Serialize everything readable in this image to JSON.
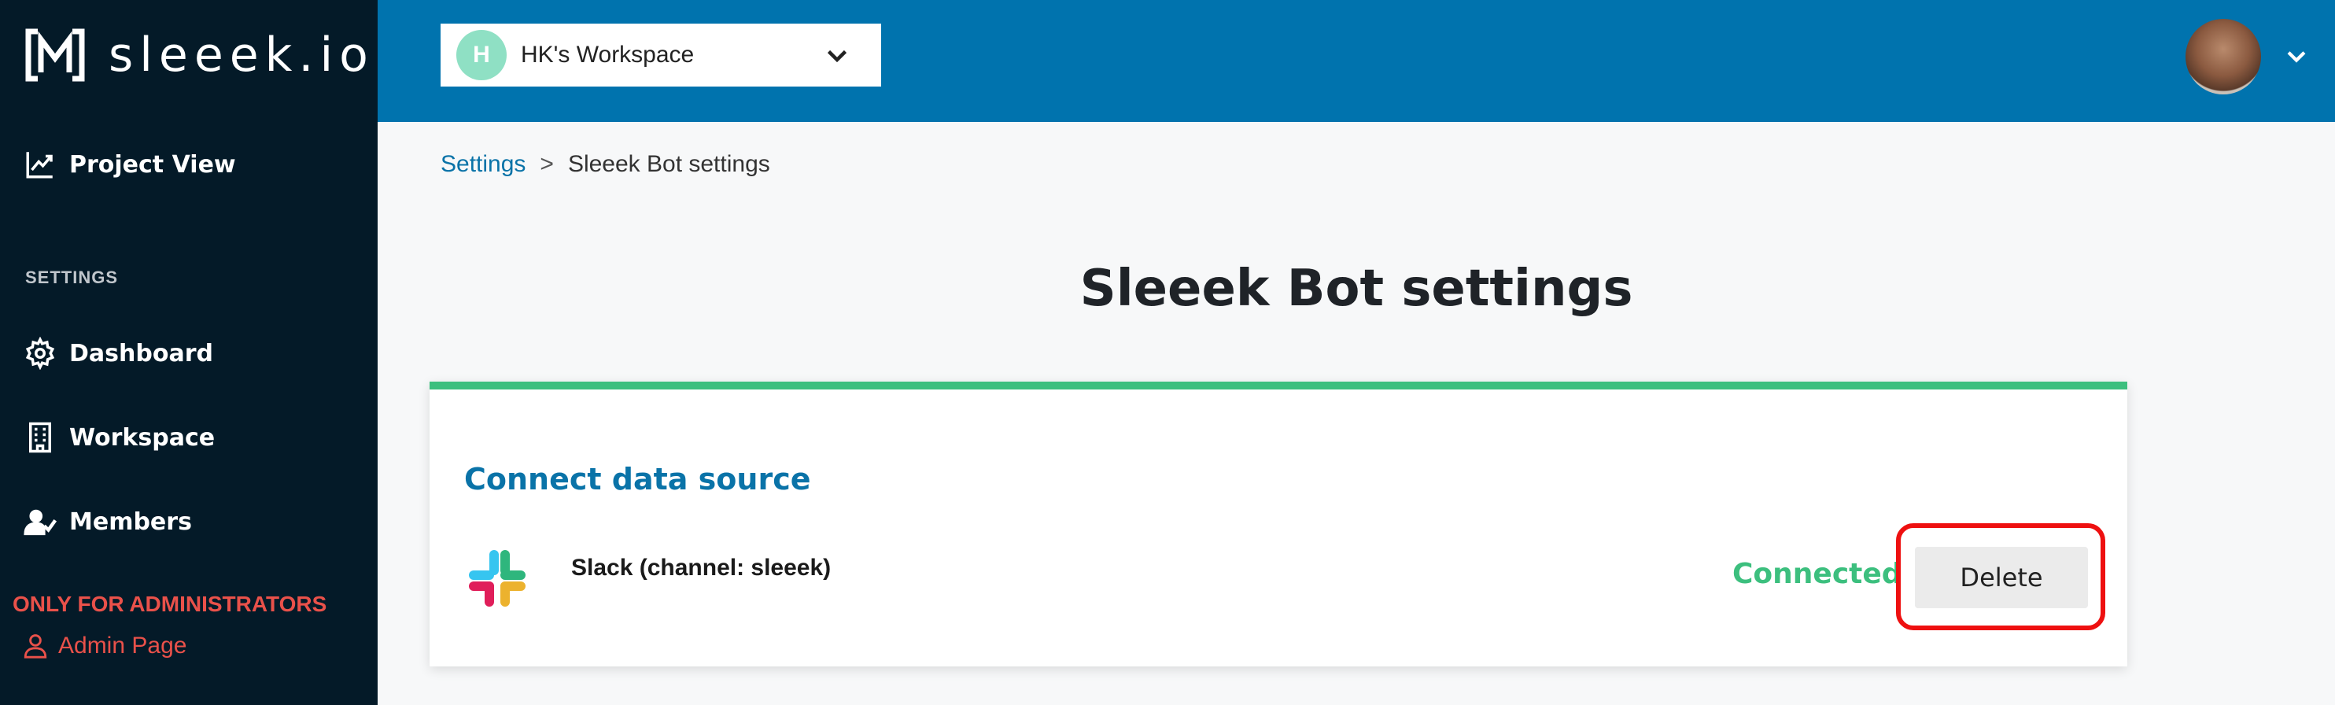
{
  "sidebar": {
    "logo_text": "sleeek.io",
    "project_view": "Project View",
    "settings_section": "SETTINGS",
    "items": [
      {
        "label": "Dashboard",
        "icon": "gear-icon"
      },
      {
        "label": "Workspace",
        "icon": "building-icon"
      },
      {
        "label": "Members",
        "icon": "user-check-icon"
      }
    ],
    "admin_label": "ONLY FOR ADMINISTRATORS",
    "admin_link": "Admin Page"
  },
  "header": {
    "workspace_initial": "H",
    "workspace_name": "HK's Workspace"
  },
  "breadcrumb": {
    "parent": "Settings",
    "separator": ">",
    "current": "Sleeek Bot settings"
  },
  "main": {
    "title": "Sleeek Bot settings",
    "card": {
      "heading": "Connect data source",
      "source_name": "Slack (channel: sleeek)",
      "status": "Connected",
      "delete_label": "Delete"
    }
  },
  "colors": {
    "sidebar_bg": "#041a28",
    "header_bg": "#0073ae",
    "accent_green": "#3cbf7e",
    "link_blue": "#0a73a8",
    "admin_red": "#e9514a",
    "highlight_red": "#ee1010"
  }
}
